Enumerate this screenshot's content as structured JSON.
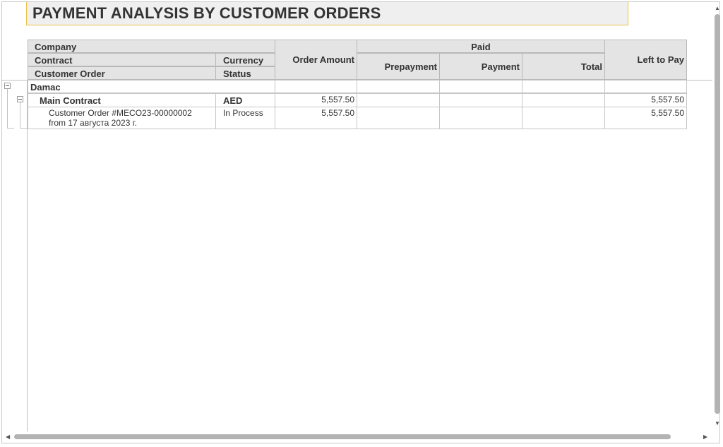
{
  "report": {
    "title": "PAYMENT ANALYSIS BY CUSTOMER ORDERS"
  },
  "headers": {
    "company": "Company",
    "contract": "Contract",
    "currency": "Currency",
    "customer_order": "Customer Order",
    "status": "Status",
    "order_amount": "Order Amount",
    "paid": "Paid",
    "prepayment": "Prepayment",
    "payment": "Payment",
    "total": "Total",
    "left_to_pay": "Left to Pay"
  },
  "rows": {
    "company": {
      "name": "Damac"
    },
    "contract": {
      "name": "Main Contract",
      "currency": "AED",
      "order_amount": "5,557.50",
      "left_to_pay": "5,557.50"
    },
    "order": {
      "line1": "Customer Order #MECO23-00000002",
      "line2": "from 17 августа 2023 г.",
      "status": "In Process",
      "order_amount": "5,557.50",
      "left_to_pay": "5,557.50"
    }
  }
}
